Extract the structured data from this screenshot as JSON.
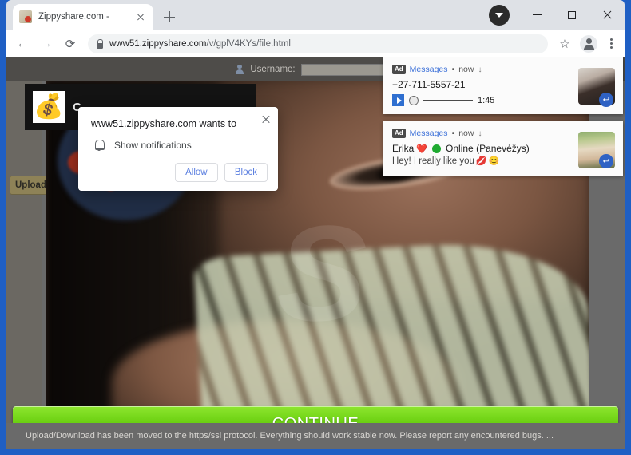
{
  "window": {
    "minimize_label": "–",
    "maximize_label": "□",
    "close_label": "×"
  },
  "tabstrip": {
    "tab_title": "Zippyshare.com -",
    "tab_close_label": "",
    "new_tab_label": ""
  },
  "toolbar": {
    "back_label": "←",
    "forward_label": "→",
    "reload_label": "⟳",
    "url_prefix": "www51.zippyshare.com",
    "url_path": "/v/gplV4KYs/file.html",
    "star_label": "☆",
    "menu_label": ""
  },
  "site": {
    "username_label": "Username:",
    "username_value": "",
    "upload_label": "Upload",
    "bag_emoji": "💰",
    "bag_text": "C",
    "watermark_text": "S",
    "continue_label": "CONTINUE",
    "status_text": "Upload/Download has been moved to the https/ssl protocol. Everything should work stable now. Please report any encountered bugs. ..."
  },
  "permission_dialog": {
    "title": "www51.zippyshare.com wants to",
    "option_label": "Show notifications",
    "allow_label": "Allow",
    "block_label": "Block",
    "close_label": ""
  },
  "notifications": [
    {
      "ad_badge": "Ad",
      "source": "Messages",
      "separator": "•",
      "time": "now",
      "caret": "↓",
      "line1": "+27-711-5557-21",
      "line2": "",
      "audio_time": "1:45",
      "has_audio": true,
      "reply_label": "↩"
    },
    {
      "ad_badge": "Ad",
      "source": "Messages",
      "separator": "•",
      "time": "now",
      "caret": "↓",
      "line1_name": "Erika",
      "line1_heart": "❤️",
      "line1_status": "Online (Panevėžys)",
      "line2": "Hey! I really like you",
      "line2_emoji1": "💋",
      "line2_emoji2": "😊",
      "has_audio": false,
      "reply_label": "↩"
    }
  ],
  "colors": {
    "accent_blue": "#1f5fc4",
    "continue_green": "#69cf10",
    "link_blue": "#3a6fd8",
    "button_text_blue": "#5b7fe0",
    "online_green": "#1faa31"
  }
}
